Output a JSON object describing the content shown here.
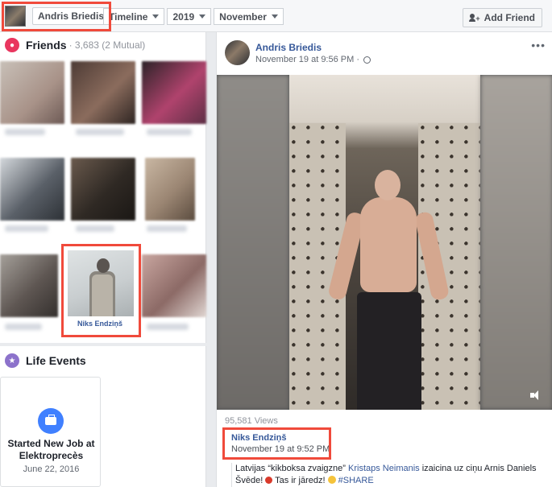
{
  "topbar": {
    "name": "Andris Briedis",
    "crumbs": [
      "Timeline",
      "2019",
      "November"
    ],
    "add_friend": "Add Friend"
  },
  "friends": {
    "title": "Friends",
    "sub": "· 3,683 (2 Mutual)",
    "highlighted_friend": "Niks Endziņš"
  },
  "life_events": {
    "title": "Life Events",
    "job_title": "Started New Job at Elektroprecès",
    "job_date": "June 22, 2016"
  },
  "post": {
    "author": "Andris Briedis",
    "time": "November 19 at 9:56 PM ·",
    "views": "95,581 Views",
    "comment": {
      "name": "Niks Endziņš",
      "time": "November 19 at 9:52 PM",
      "text_pre": "Latvijas “kikboksa zvaigzne” ",
      "mention": "Kristaps Neimanis",
      "text_mid": " izaicina uz ciņu Arnis Daniels Švēde! ",
      "text_after_glove": " Tas ir jāredz! ",
      "hashtag": "#SHARE"
    }
  },
  "colors": {
    "highlight": "#f04a3b",
    "link": "#365899",
    "friends_icon": "#e9365f",
    "life_icon": "#8c72cb"
  }
}
